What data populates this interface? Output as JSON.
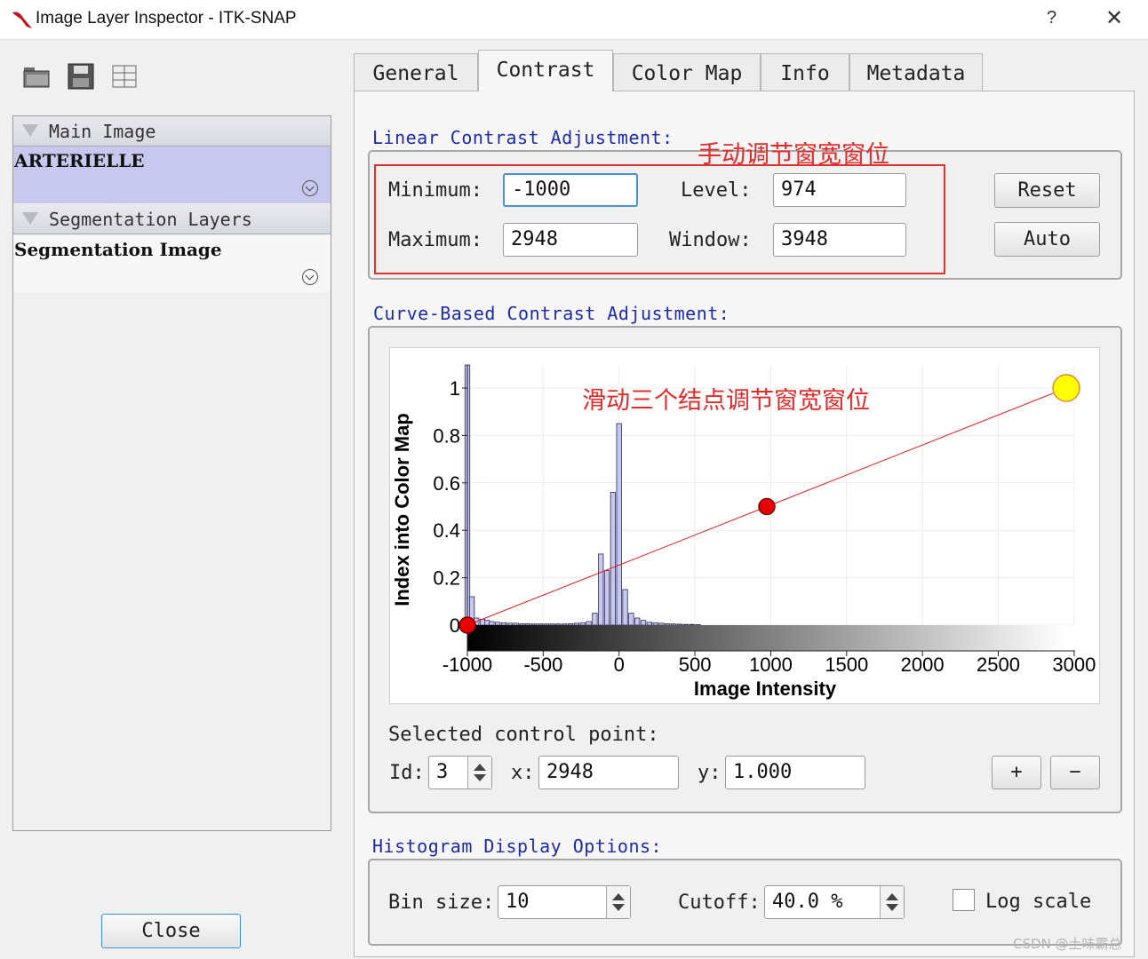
{
  "window": {
    "title": "Image Layer Inspector - ITK-SNAP",
    "help": "?",
    "close": "✕"
  },
  "toolbar": {
    "icons": [
      "open-folder-icon",
      "save-icon",
      "layout-icon"
    ]
  },
  "layers": {
    "main_section": "Main Image",
    "main_item": "ARTERIELLE",
    "seg_section": "Segmentation Layers",
    "seg_item": "Segmentation Image"
  },
  "close_button": "Close",
  "tabs": [
    "General",
    "Contrast",
    "Color Map",
    "Info",
    "Metadata"
  ],
  "active_tab": "Contrast",
  "linear": {
    "title": "Linear Contrast Adjustment:",
    "min_label": "Minimum:",
    "min_value": "-1000",
    "max_label": "Maximum:",
    "max_value": "2948",
    "level_label": "Level:",
    "level_value": "974",
    "window_label": "Window:",
    "window_value": "3948",
    "reset": "Reset",
    "auto": "Auto"
  },
  "annotations": {
    "manual": "手动调节窗宽窗位",
    "curve": "滑动三个结点调节窗宽窗位"
  },
  "curve": {
    "title": "Curve-Based Contrast Adjustment:",
    "selected_label": "Selected control point:",
    "id_label": "Id:",
    "id_value": "3",
    "x_label": "x:",
    "x_value": "2948",
    "y_label": "y:",
    "y_value": "1.000",
    "plus": "+",
    "minus": "−"
  },
  "chart_data": {
    "type": "line",
    "xlabel": "Image Intensity",
    "ylabel": "Index into Color Map",
    "xlim": [
      -1100,
      3000
    ],
    "ylim": [
      0,
      1.1
    ],
    "x_ticks": [
      "-1000",
      "-500",
      "0",
      "500",
      "1000",
      "1500",
      "2000",
      "2500",
      "3000"
    ],
    "y_ticks": [
      "0",
      "0.2",
      "0.4",
      "0.6",
      "0.8",
      "1"
    ],
    "grid": true,
    "control_points": [
      {
        "x": -1000,
        "y": 0.0,
        "color": "#e60000"
      },
      {
        "x": 974,
        "y": 0.5,
        "color": "#e60000"
      },
      {
        "x": 2948,
        "y": 1.0,
        "color": "#ffff00"
      }
    ],
    "line_color": "#e02020",
    "histogram": {
      "bin_x": [
        -1000,
        -970,
        -940,
        -900,
        -870,
        -840,
        -800,
        -760,
        -720,
        -680,
        -640,
        -600,
        -560,
        -520,
        -480,
        -440,
        -400,
        -360,
        -320,
        -280,
        -240,
        -200,
        -160,
        -120,
        -80,
        -40,
        0,
        40,
        80,
        120,
        160,
        200,
        240,
        280,
        320,
        360,
        400,
        440,
        480,
        520
      ],
      "bin_y": [
        1.1,
        0.12,
        0.03,
        0.025,
        0.02,
        0.015,
        0.012,
        0.01,
        0.008,
        0.008,
        0.006,
        0.006,
        0.005,
        0.005,
        0.005,
        0.005,
        0.005,
        0.005,
        0.006,
        0.008,
        0.01,
        0.015,
        0.05,
        0.3,
        0.23,
        0.56,
        0.85,
        0.15,
        0.05,
        0.03,
        0.02,
        0.012,
        0.01,
        0.008,
        0.006,
        0.005,
        0.004,
        0.003,
        0.003,
        0.002
      ],
      "fill": "#c7c7f0"
    }
  },
  "histogram_options": {
    "title": "Histogram Display Options:",
    "bin_label": "Bin size:",
    "bin_value": "10",
    "cutoff_label": "Cutoff:",
    "cutoff_value": "40.0 %",
    "log_label": "Log scale",
    "log_checked": false
  },
  "watermark": "CSDN @土味霸总"
}
